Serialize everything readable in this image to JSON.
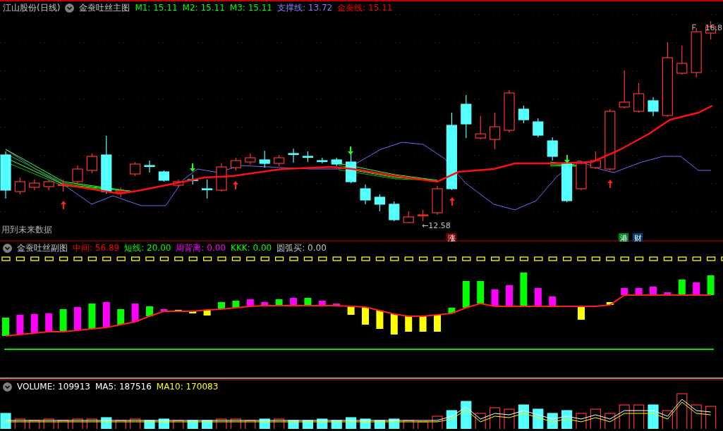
{
  "main_header": {
    "stock": "江山股份(日线)",
    "indicator": "金蚕吐丝主图",
    "values": [
      {
        "text": "M1: 15.11",
        "color": "#00ff00"
      },
      {
        "text": "M2: 15.11",
        "color": "#00ff00"
      },
      {
        "text": "M3: 15.11",
        "color": "#00ff00"
      },
      {
        "text": "支撑线: 13.72",
        "color": "#8080ff"
      },
      {
        "text": "金蚕线: 15.11",
        "color": "#ff0000"
      }
    ]
  },
  "main_chart": {
    "high_label": "16.8",
    "low_label": "←12.58",
    "note": "用到未来数据",
    "badges": [
      {
        "text": "涨",
        "color": "#800000"
      },
      {
        "text": "港",
        "color": "#008020"
      },
      {
        "text": "财",
        "color": "#003c78"
      }
    ]
  },
  "sub_header": {
    "indicator": "金蚕吐丝副图",
    "values": [
      {
        "text": "中间: 56.89",
        "color": "#ff0000"
      },
      {
        "text": "短线: 20.00",
        "color": "#00ff00"
      },
      {
        "text": "周背离: 0.00",
        "color": "#ff00ff"
      },
      {
        "text": "KKK: 0.00",
        "color": "#00ff00"
      },
      {
        "text": "圆弧买: 0.00",
        "color": "#c0c0c0"
      }
    ]
  },
  "volume_header": {
    "values": [
      {
        "text": "VOLUME: 109913",
        "color": "#ffffff"
      },
      {
        "text": "MA5: 187516",
        "color": "#ffffff"
      },
      {
        "text": "MA10: 170083",
        "color": "#ffff00"
      }
    ]
  }
}
